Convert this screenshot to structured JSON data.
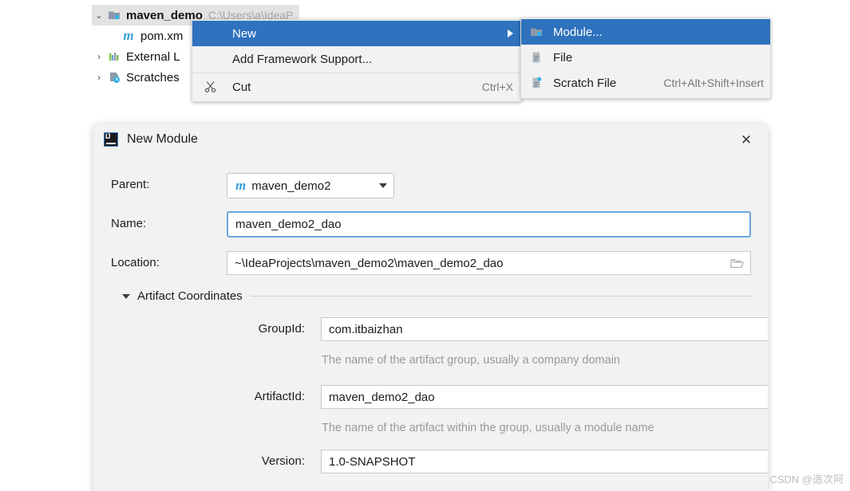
{
  "project_tree": {
    "rows": [
      {
        "twisty": "v",
        "icon": "module-folder-icon",
        "label": "maven_demo",
        "path": "C:\\Users\\a\\IdeaP",
        "selected": true,
        "bold": true
      },
      {
        "twisty": "",
        "icon": "maven-m-icon",
        "label": "pom.xm",
        "path": "",
        "selected": false,
        "bold": false
      },
      {
        "twisty": ">",
        "icon": "external-libraries-icon",
        "label": "External L",
        "path": "",
        "selected": false,
        "bold": false
      },
      {
        "twisty": ">",
        "icon": "scratches-icon",
        "label": "Scratches",
        "path": "",
        "selected": false,
        "bold": false
      }
    ]
  },
  "context_menu": {
    "items": [
      {
        "label": "New",
        "accel": "",
        "icon": "",
        "highlighted": true,
        "has_submenu": true
      },
      {
        "label": "Add Framework Support...",
        "accel": "",
        "icon": "",
        "highlighted": false,
        "has_submenu": false
      },
      {
        "label": "Cut",
        "accel": "Ctrl+X",
        "icon": "scissors-icon",
        "highlighted": false,
        "has_submenu": false
      }
    ]
  },
  "new_submenu": {
    "items": [
      {
        "label": "Module...",
        "accel": "",
        "icon": "module-icon",
        "highlighted": true
      },
      {
        "label": "File",
        "accel": "",
        "icon": "file-icon",
        "highlighted": false
      },
      {
        "label": "Scratch File",
        "accel": "Ctrl+Alt+Shift+Insert",
        "icon": "scratch-file-icon",
        "highlighted": false
      }
    ]
  },
  "dialog": {
    "title": "New Module",
    "close_label": "✕",
    "parent": {
      "label": "Parent:",
      "value": "maven_demo2",
      "icon_glyph": "m"
    },
    "name": {
      "label": "Name:",
      "value": "maven_demo2_dao",
      "placeholder": ""
    },
    "location": {
      "label": "Location:",
      "value": "~\\IdeaProjects\\maven_demo2\\maven_demo2_dao",
      "placeholder": "",
      "browse_icon": "folder-open-icon"
    },
    "artifact_section": {
      "title": "Artifact Coordinates",
      "expanded": true
    },
    "group_id": {
      "label": "GroupId:",
      "value": "com.itbaizhan",
      "hint": "The name of the artifact group, usually a company domain"
    },
    "artifact_id": {
      "label": "ArtifactId:",
      "value": "maven_demo2_dao",
      "hint": "The name of the artifact within the group, usually a module name"
    },
    "version": {
      "label": "Version:",
      "value": "1.0-SNAPSHOT",
      "hint": ""
    }
  },
  "watermark": "CSDN @造次阿",
  "colors": {
    "menu_highlight": "#2f72bd",
    "focus_border": "#6aa6e0",
    "dialog_bg": "#f2f2f2",
    "hint_text": "#9a9a9a",
    "maven_m": "#389fd6"
  }
}
